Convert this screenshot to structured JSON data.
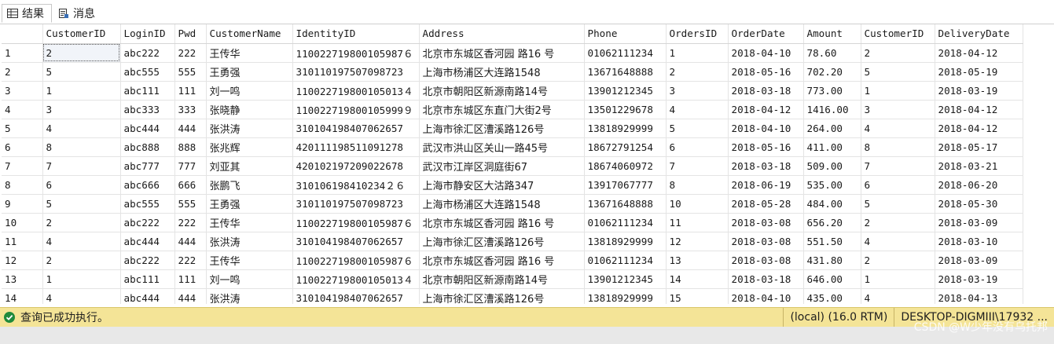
{
  "tabs": [
    {
      "label": "结果",
      "icon": "grid-icon",
      "active": true
    },
    {
      "label": "消息",
      "icon": "message-icon",
      "active": false
    }
  ],
  "grid": {
    "columns": [
      "CustomerID",
      "LoginID",
      "Pwd",
      "CustomerName",
      "IdentityID",
      "Address",
      "Phone",
      "OrdersID",
      "OrderDate",
      "Amount",
      "CustomerID",
      "DeliveryDate"
    ],
    "rows": [
      [
        "1",
        "2",
        "abc222",
        "222",
        "王传华",
        "110022719800105987６",
        "北京市东城区香河园 路16 号",
        "01062111234",
        "1",
        "2018-04-10",
        "78.60",
        "2",
        "2018-04-12"
      ],
      [
        "2",
        "5",
        "abc555",
        "555",
        "王勇强",
        "310110197507098723",
        "上海市杨浦区大连路1548",
        "13671648888",
        "2",
        "2018-05-16",
        "702.20",
        "5",
        "2018-05-19"
      ],
      [
        "3",
        "1",
        "abc111",
        "111",
        "刘一鸣",
        "110022719800105013４",
        "北京市朝阳区新源南路14号",
        "13901212345",
        "3",
        "2018-03-18",
        "773.00",
        "1",
        "2018-03-19"
      ],
      [
        "4",
        "3",
        "abc333",
        "333",
        "张晓静",
        "110022719800105999９",
        "北京市东城区东直门大街2号",
        "13501229678",
        "4",
        "2018-04-12",
        "1416.00",
        "3",
        "2018-04-12"
      ],
      [
        "5",
        "4",
        "abc444",
        "444",
        "张洪涛",
        "310104198407062657",
        "上海市徐汇区漕溪路126号",
        "13818929999",
        "5",
        "2018-04-10",
        "264.00",
        "4",
        "2018-04-12"
      ],
      [
        "6",
        "8",
        "abc888",
        "888",
        "张兆辉",
        "420111198511091278",
        "武汉市洪山区关山一路45号",
        "18672791254",
        "6",
        "2018-05-16",
        "411.00",
        "8",
        "2018-05-17"
      ],
      [
        "7",
        "7",
        "abc777",
        "777",
        "刘亚其",
        "420102197209022678",
        "武汉市江岸区洞庭街67",
        "18674060972",
        "7",
        "2018-03-18",
        "509.00",
        "7",
        "2018-03-21"
      ],
      [
        "8",
        "6",
        "abc666",
        "666",
        "张鹏飞",
        " 310106198410234２６",
        "上海市静安区大沽路347",
        "13917067777",
        "8",
        "2018-06-19",
        "535.00",
        "6",
        "2018-06-20"
      ],
      [
        "9",
        "5",
        "abc555",
        "555",
        "王勇强",
        "310110197507098723",
        "上海市杨浦区大连路1548",
        "13671648888",
        "10",
        "2018-05-28",
        "484.00",
        "5",
        "2018-05-30"
      ],
      [
        "10",
        "2",
        "abc222",
        "222",
        "王传华",
        "110022719800105987６",
        "北京市东城区香河园 路16 号",
        "01062111234",
        "11",
        "2018-03-08",
        "656.20",
        "2",
        "2018-03-09"
      ],
      [
        "11",
        "4",
        "abc444",
        "444",
        "张洪涛",
        "310104198407062657",
        "上海市徐汇区漕溪路126号",
        "13818929999",
        "12",
        "2018-03-08",
        "551.50",
        "4",
        "2018-03-10"
      ],
      [
        "12",
        "2",
        "abc222",
        "222",
        "王传华",
        "110022719800105987６",
        "北京市东城区香河园 路16 号",
        "01062111234",
        "13",
        "2018-03-08",
        "431.80",
        "2",
        "2018-03-09"
      ],
      [
        "13",
        "1",
        "abc111",
        "111",
        "刘一鸣",
        "110022719800105013４",
        "北京市朝阳区新源南路14号",
        "13901212345",
        "14",
        "2018-03-18",
        "646.00",
        "1",
        "2018-03-19"
      ],
      [
        "14",
        "4",
        "abc444",
        "444",
        "张洪涛",
        "310104198407062657",
        "上海市徐汇区漕溪路126号",
        "13818929999",
        "15",
        "2018-04-10",
        "435.00",
        "4",
        "2018-04-13"
      ]
    ]
  },
  "status": {
    "message": "查询已成功执行。",
    "server": "(local) (16.0 RTM)",
    "connection": "DESKTOP-DIGMIII\\17932 ..."
  },
  "watermark": "CSDN @W少年没有乌托邦",
  "colors": {
    "status_bg": "#f4e497",
    "ok_green": "#1f8a3b"
  }
}
